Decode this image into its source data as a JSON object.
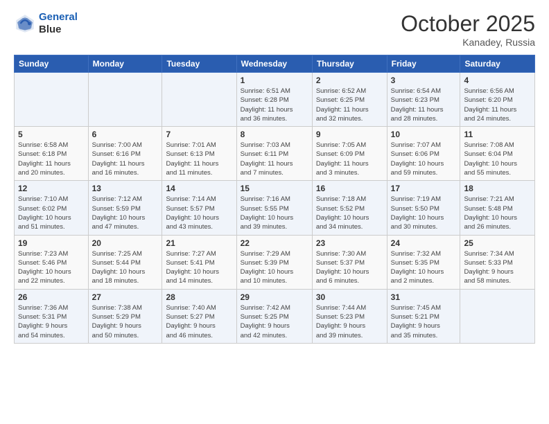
{
  "header": {
    "logo_line1": "General",
    "logo_line2": "Blue",
    "month": "October 2025",
    "location": "Kanadey, Russia"
  },
  "weekdays": [
    "Sunday",
    "Monday",
    "Tuesday",
    "Wednesday",
    "Thursday",
    "Friday",
    "Saturday"
  ],
  "weeks": [
    [
      {
        "day": "",
        "info": ""
      },
      {
        "day": "",
        "info": ""
      },
      {
        "day": "",
        "info": ""
      },
      {
        "day": "1",
        "info": "Sunrise: 6:51 AM\nSunset: 6:28 PM\nDaylight: 11 hours\nand 36 minutes."
      },
      {
        "day": "2",
        "info": "Sunrise: 6:52 AM\nSunset: 6:25 PM\nDaylight: 11 hours\nand 32 minutes."
      },
      {
        "day": "3",
        "info": "Sunrise: 6:54 AM\nSunset: 6:23 PM\nDaylight: 11 hours\nand 28 minutes."
      },
      {
        "day": "4",
        "info": "Sunrise: 6:56 AM\nSunset: 6:20 PM\nDaylight: 11 hours\nand 24 minutes."
      }
    ],
    [
      {
        "day": "5",
        "info": "Sunrise: 6:58 AM\nSunset: 6:18 PM\nDaylight: 11 hours\nand 20 minutes."
      },
      {
        "day": "6",
        "info": "Sunrise: 7:00 AM\nSunset: 6:16 PM\nDaylight: 11 hours\nand 16 minutes."
      },
      {
        "day": "7",
        "info": "Sunrise: 7:01 AM\nSunset: 6:13 PM\nDaylight: 11 hours\nand 11 minutes."
      },
      {
        "day": "8",
        "info": "Sunrise: 7:03 AM\nSunset: 6:11 PM\nDaylight: 11 hours\nand 7 minutes."
      },
      {
        "day": "9",
        "info": "Sunrise: 7:05 AM\nSunset: 6:09 PM\nDaylight: 11 hours\nand 3 minutes."
      },
      {
        "day": "10",
        "info": "Sunrise: 7:07 AM\nSunset: 6:06 PM\nDaylight: 10 hours\nand 59 minutes."
      },
      {
        "day": "11",
        "info": "Sunrise: 7:08 AM\nSunset: 6:04 PM\nDaylight: 10 hours\nand 55 minutes."
      }
    ],
    [
      {
        "day": "12",
        "info": "Sunrise: 7:10 AM\nSunset: 6:02 PM\nDaylight: 10 hours\nand 51 minutes."
      },
      {
        "day": "13",
        "info": "Sunrise: 7:12 AM\nSunset: 5:59 PM\nDaylight: 10 hours\nand 47 minutes."
      },
      {
        "day": "14",
        "info": "Sunrise: 7:14 AM\nSunset: 5:57 PM\nDaylight: 10 hours\nand 43 minutes."
      },
      {
        "day": "15",
        "info": "Sunrise: 7:16 AM\nSunset: 5:55 PM\nDaylight: 10 hours\nand 39 minutes."
      },
      {
        "day": "16",
        "info": "Sunrise: 7:18 AM\nSunset: 5:52 PM\nDaylight: 10 hours\nand 34 minutes."
      },
      {
        "day": "17",
        "info": "Sunrise: 7:19 AM\nSunset: 5:50 PM\nDaylight: 10 hours\nand 30 minutes."
      },
      {
        "day": "18",
        "info": "Sunrise: 7:21 AM\nSunset: 5:48 PM\nDaylight: 10 hours\nand 26 minutes."
      }
    ],
    [
      {
        "day": "19",
        "info": "Sunrise: 7:23 AM\nSunset: 5:46 PM\nDaylight: 10 hours\nand 22 minutes."
      },
      {
        "day": "20",
        "info": "Sunrise: 7:25 AM\nSunset: 5:44 PM\nDaylight: 10 hours\nand 18 minutes."
      },
      {
        "day": "21",
        "info": "Sunrise: 7:27 AM\nSunset: 5:41 PM\nDaylight: 10 hours\nand 14 minutes."
      },
      {
        "day": "22",
        "info": "Sunrise: 7:29 AM\nSunset: 5:39 PM\nDaylight: 10 hours\nand 10 minutes."
      },
      {
        "day": "23",
        "info": "Sunrise: 7:30 AM\nSunset: 5:37 PM\nDaylight: 10 hours\nand 6 minutes."
      },
      {
        "day": "24",
        "info": "Sunrise: 7:32 AM\nSunset: 5:35 PM\nDaylight: 10 hours\nand 2 minutes."
      },
      {
        "day": "25",
        "info": "Sunrise: 7:34 AM\nSunset: 5:33 PM\nDaylight: 9 hours\nand 58 minutes."
      }
    ],
    [
      {
        "day": "26",
        "info": "Sunrise: 7:36 AM\nSunset: 5:31 PM\nDaylight: 9 hours\nand 54 minutes."
      },
      {
        "day": "27",
        "info": "Sunrise: 7:38 AM\nSunset: 5:29 PM\nDaylight: 9 hours\nand 50 minutes."
      },
      {
        "day": "28",
        "info": "Sunrise: 7:40 AM\nSunset: 5:27 PM\nDaylight: 9 hours\nand 46 minutes."
      },
      {
        "day": "29",
        "info": "Sunrise: 7:42 AM\nSunset: 5:25 PM\nDaylight: 9 hours\nand 42 minutes."
      },
      {
        "day": "30",
        "info": "Sunrise: 7:44 AM\nSunset: 5:23 PM\nDaylight: 9 hours\nand 39 minutes."
      },
      {
        "day": "31",
        "info": "Sunrise: 7:45 AM\nSunset: 5:21 PM\nDaylight: 9 hours\nand 35 minutes."
      },
      {
        "day": "",
        "info": ""
      }
    ]
  ]
}
